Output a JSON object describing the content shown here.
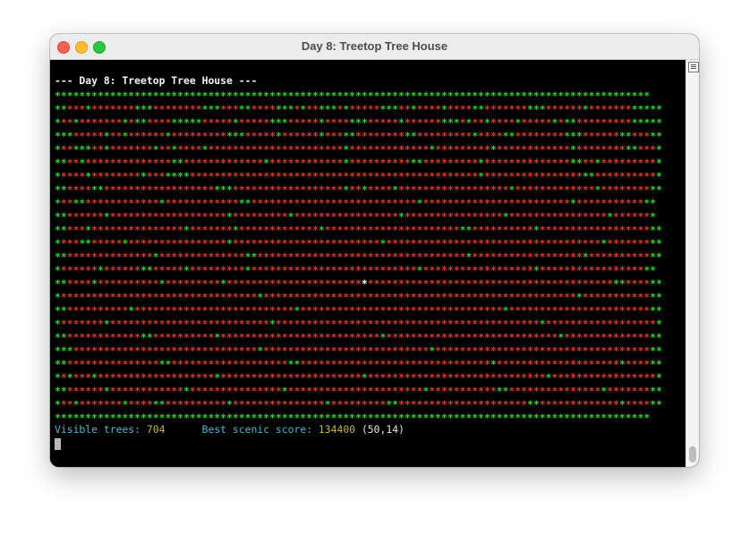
{
  "window": {
    "title": "Day 8: Treetop Tree House"
  },
  "terminal": {
    "header": "--- Day 8: Treetop Tree House ---",
    "visible_label": "Visible trees: ",
    "visible_value": "704",
    "score_label": "Best scenic score: ",
    "score_value": "134400",
    "score_coords": "(50,14)",
    "gap": "      "
  },
  "grid": {
    "cols": 99,
    "rows": 25,
    "best_tree": {
      "col": 50,
      "row": 14
    },
    "rows_data": [
      "VVVVVVVVVVVVVVVVVVVVVVVVVVVVVVVVVVVVVVVVVVVVVVVVVVVVVVVVVVVVVVVVVVVVVVVVVVVVVVVVVVVVVVVVVVVVVVVVV",
      "VVHHHVHHHHHHHVVVHHHHHHHHVVVHHHVVHHHHVVVHVHHVVVHVHHHHHVVVHHVHHHHVHHHHVVHHHHHHHVVVHHHHHHVHHHHHHHVVVVV",
      "VHHVHHHHHHHVHVVHHHHVVVVVHHHHHVHHHHHVVVHHHHHVHHHHVVVHHHHHVHHHHHHVVVHVHHVHHHHVHHHHHVHVVHHHHHHHHHVVVVV",
      "VVVHHHHHVHHVHHHHHHVHHHHHHHHHVVVHHHHHVHHHHHHVHHHVVHHHHHHHHVVHHHHHHHHHVHHHHVVHHHHHHHHVVVHHHHHHVVHHHVV",
      "VHHVVVHHVHHHHHHHVHHVHHHHVHHHHHHHHHHHHHHHHHHHHHHVHHHHHHHHHHHHHVHHHHHHHHHVHHHHHHHHHHHHVHHHHHHHHVVHHHV",
      "VVHHVHHHHHHHHHHHHHHVVHHHHHHHHHHHHHVHHHHHHHHHHHHVHHHHHHHHHHVVHHHHHHHHHVHHHHHHHHHHHHHHVVHHVHHHHHHHHHV",
      "VHHHHVHHHHHHHHVHHHVVVVHHHHHHHHHHHHHHHHHHHHHHHHHHHHHHHHHHHHHHHHHHHHHHHVHHHHHHHHHHHHHHHHVVHHHHHHHHHHV",
      "VVHHHHVVHHHHHHHHHHHHHHHHHHVVVHHHHHHHHHHHHHHHHHHVHHVHHHHVHHHHHHHHHHHHHHHHHHVHHHHHHHHHHHHHVHHHHHHHHVV",
      "VHHVVHHHHHHHHHHHHVHHHHHHHHHHHHVVHHHHHHHHHHHHHHHHHHHHHHHHHHHVHHHHHHHHHHHHHHHHHHHHHHHHVHHHHHHHHHHHVV",
      "VVHHHHHHVHHHHHHHHHHHHHHHHHHHVHHHHHHHHHVHHHHHHHHHHHHHHHHHVHHHHHHHHHHHHHHHHVHHHHHHHHHHHHHHHHVHHHHHHV",
      "VVHHHVHHHHHHHHHHHHHHHVHHHHHHHVHHHHHHHHHHHHHVHHHHHHHHHHHHHHHHHHHHHHVVHHHHHHHHHHVHHHHHHHHHHHHHHHHHHVV",
      "VHHHVVHHHHHVHHHHHHHHHHHHHHHHVHHHHHHHHHHHHHHHHHHHHHHHHVHHHHHHHHHHHHHHHHHHHHHHHHHHHHHHHHHHHVHHHHHHHVV",
      "VVHHHHHHHHHHHHHHVHHHHHHHHHHHHHHVVHHHHHHHHHHHHHHHHHHHHHHHHHHHHHHHHHHVHHHHHHHHHHHHHHHHHHVHHHHHHHHHHVV",
      "VHHHHHHVHHHHHHVVHHHHHVHHHHHHHHHVHHHHHHHHHHHHHHHHHHHHHHHHHHHVHHHHHHHHHHHHHHHHHHVHHHHHHHHHHHHHHHHHVV",
      "VVHHHHVHHHHHHHHHHVHHHHHHHHHVHHHHHHHHHHHHHHHHHHHHHHBHHHHHHHHHHHHHHHHHHHHHHHHHHHHHHHHHHHHHHHHVVHHHHVV",
      "VHHHHHHHHHHHHHHHHHHHHHHHHHHHHHHHHVHHHHHHHHHHHHHHHHHHHHHHHHHHHHHHHHHHHHHHHHHHHHHHHHHHHVHHHHHHHHHHHVV",
      "VVHHHHHHHHHHVHHHHHHHHHHHHHHHHHHHHHHHHHHVHHHHHHHHHHHHHHHHHHHHHHHHHHHHHHHHHVHHHHHHHHHHHHHHHHHHHHHHHVV",
      "VHHHHHHHVHHHHHHHHHHHHHHHHHHHHHHHHHHVHHHHHHHHHHHHHHHHHHHHHHHHHHHHHHHHHHHHHHHHHHHVHHHHHHHHHHHHHHHHHHV",
      "VVHHHHHHHHHHHHVVHHHHHHHHHHVHHHHHHHHHHHHHHHHHHHHHHHHHHVHHHHHHHHHHHHHHHHHHHHHHHHHHHHVHHHHHHHHHHHHHHVV",
      "VVVHHHHHHHHHHHHHHHHHHHHHHHHHHHHHHVHHHHHHHHHHHHHHHHHHHHHHHHHHHVHHHHHHHHHHHHHHHHHHHHHHHHHHHHHHHHHHHVV",
      "VVHHHHHHHHHHHHHHHVVHHHHHHHHHHHHHHHHHHHVVHHHHHHHHHHHHHHHHHHHHHHHHHHHHHHHVHHHHHHHHHHHHHHHHHHHHVHHHHVV",
      "VHVHHHVHHHHHHHHHHHHHHHHHHHVHHHHHHHHHHHHHHHHHHHHHHHVHHHHHHHHHHHHHHHHHHHHHHHHHHHHHVHHHHHHHHHHHHHHHHHV",
      "VVHHHHHHVHHHHHHHHHHHHVHHHHHHHHHHHHHHHVHHHHHHHHHHHHHHHHHHHHHHVHHHHHHHHHHHVVHHHHHHHHHHHHHHHVHHHHHHHVV",
      "VHHVHHHHHHHVHHHHVVHHHHHHHHHHVHHHHHHHHHHHHHHHVHHHHHHHHHVVHHHHHHHHHHHHHHHHHHHHHVVHHHHHHHHHHHHHVHHHHVV",
      "VVVVVVVVVVVVVVVVVVVVVVVVVVVVVVVVVVVVVVVVVVVVVVVVVVVVVVVVVVVVVVVVVVVVVVVVVVVVVVVVVVVVVVVVVVVVVVVVV"
    ],
    "glyph": "*",
    "colors": {
      "visible": "#2fd22f",
      "hidden": "#d83a30",
      "best": "#ffffff"
    }
  }
}
